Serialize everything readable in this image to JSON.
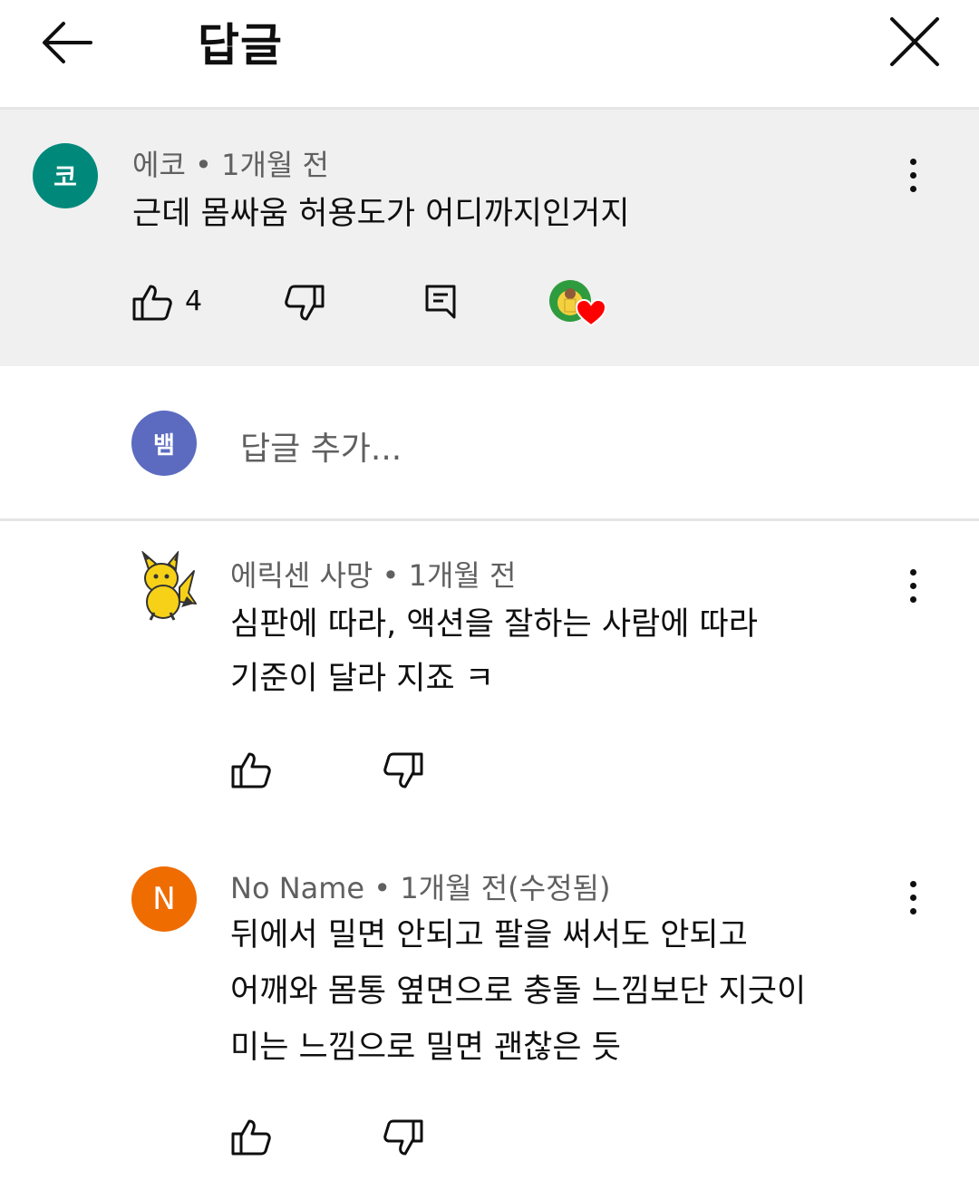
{
  "header": {
    "title": "답글"
  },
  "parent_comment": {
    "avatar_letter": "코",
    "avatar_color": "#00897b",
    "meta": "에코 • 1개월 전",
    "text": "근데 몸싸움 허용도가 어디까지인거지",
    "like_count": "4"
  },
  "reply_input": {
    "avatar_letter": "뱀",
    "avatar_color": "#5c6bc0",
    "placeholder": "답글 추가..."
  },
  "replies": [
    {
      "meta": "에릭센 사망 • 1개월 전",
      "lines": [
        "심판에 따라, 액션을 잘하는 사람에 따라",
        "기준이 달라 지죠 ㅋ"
      ]
    },
    {
      "avatar_letter": "N",
      "avatar_color": "#ef6c00",
      "meta": "No Name • 1개월 전(수정됨)",
      "lines": [
        "뒤에서 밀면 안되고 팔을 써서도 안되고",
        "어깨와 몸통 옆면으로 충돌 느낌보단 지긋이",
        "미는 느낌으로 밀면 괜찮은 듯"
      ]
    }
  ],
  "icons": {
    "back": "arrow-left-icon",
    "close": "close-icon",
    "like": "thumb-up-icon",
    "dislike": "thumb-down-icon",
    "reply": "comment-icon",
    "menu": "more-vert-icon",
    "creator_heart": "heart-icon"
  },
  "colors": {
    "heart": "#ff0000",
    "divider": "#e5e5e5",
    "highlight_bg": "#f0f0f0"
  }
}
